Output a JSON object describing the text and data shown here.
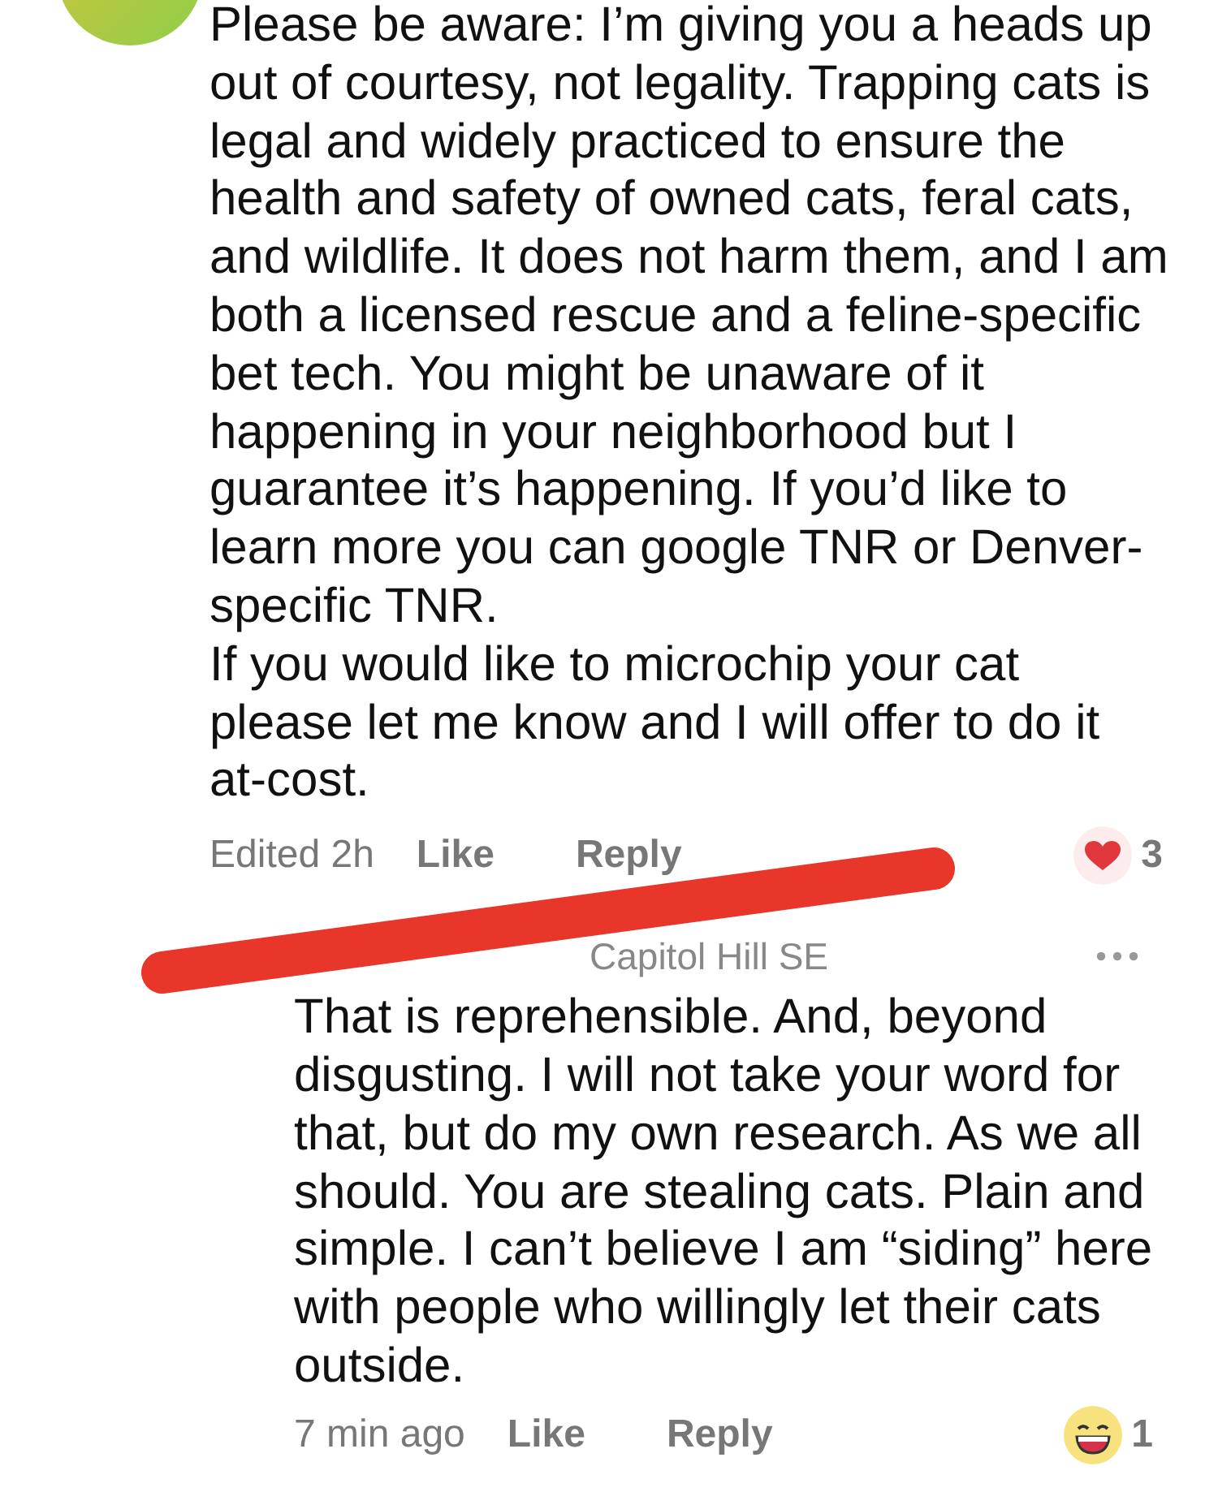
{
  "comments": [
    {
      "redacted": false,
      "paragraphs": [
        "Please be aware: I’m giving you a heads up out of courtesy, not legality. Trapping cats is legal and widely practiced to ensure the health and safety of owned cats, feral cats, and wildlife. It does not harm them, and I am both a licensed rescue and a feline-specific bet tech. You might be unaware of it happening in your neighborhood but I guarantee it’s happening. If you’d like to learn more you can google TNR or Denver-specific TNR.",
        "If you would like to microchip your cat please let me know and I will offer to do it at-cost."
      ],
      "meta": "Edited 2h",
      "actions": [
        "Like",
        "Reply"
      ],
      "reaction": {
        "kind": "heart",
        "count": "3"
      }
    },
    {
      "redacted": true,
      "neighborhood": "Capitol Hill SE",
      "paragraphs": [
        "That is reprehensible. And, beyond disgusting. I will not take your word for that, but do my own research. As we all should. You are stealing cats. Plain and simple. I can’t believe I am “siding” here with people who willingly let their cats outside."
      ],
      "meta": "7 min ago",
      "actions": [
        "Like",
        "Reply"
      ],
      "reaction": {
        "kind": "laugh",
        "count": "1"
      }
    }
  ]
}
